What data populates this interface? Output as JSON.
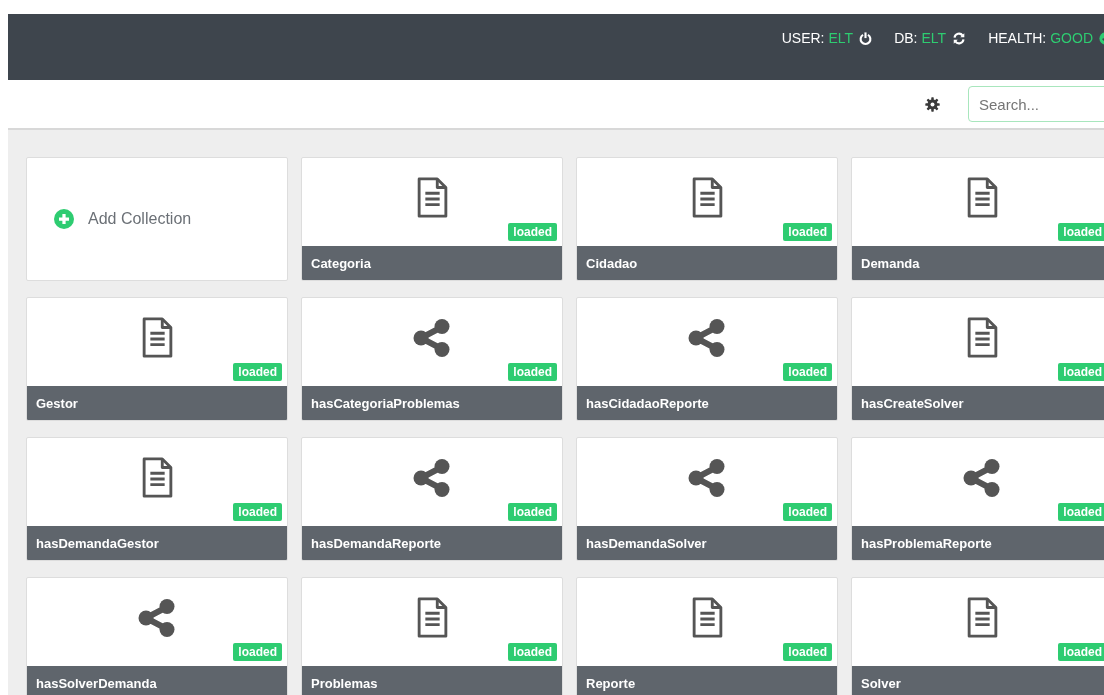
{
  "header": {
    "status": [
      {
        "kind": "user",
        "label": "USER:",
        "value": "ELT"
      },
      {
        "kind": "db",
        "label": "DB:",
        "value": "ELT"
      },
      {
        "kind": "health",
        "label": "HEALTH:",
        "value": "GOOD"
      }
    ]
  },
  "toolbar": {
    "search": {
      "placeholder": "Search..."
    }
  },
  "add_collection": {
    "label": "Add Collection"
  },
  "collections": [
    {
      "name": "Categoria",
      "kind": "document",
      "status": "loaded"
    },
    {
      "name": "Cidadao",
      "kind": "document",
      "status": "loaded"
    },
    {
      "name": "Demanda",
      "kind": "document",
      "status": "loaded"
    },
    {
      "name": "Gestor",
      "kind": "document",
      "status": "loaded"
    },
    {
      "name": "hasCategoriaProblemas",
      "kind": "edge",
      "status": "loaded"
    },
    {
      "name": "hasCidadaoReporte",
      "kind": "edge",
      "status": "loaded"
    },
    {
      "name": "hasCreateSolver",
      "kind": "document",
      "status": "loaded"
    },
    {
      "name": "hasDemandaGestor",
      "kind": "document",
      "status": "loaded"
    },
    {
      "name": "hasDemandaReporte",
      "kind": "edge",
      "status": "loaded"
    },
    {
      "name": "hasDemandaSolver",
      "kind": "edge",
      "status": "loaded"
    },
    {
      "name": "hasProblemaReporte",
      "kind": "edge",
      "status": "loaded"
    },
    {
      "name": "hasSolverDemanda",
      "kind": "edge",
      "status": "loaded"
    },
    {
      "name": "Problemas",
      "kind": "document",
      "status": "loaded"
    },
    {
      "name": "Reporte",
      "kind": "document",
      "status": "loaded"
    },
    {
      "name": "Solver",
      "kind": "document",
      "status": "loaded"
    }
  ]
}
